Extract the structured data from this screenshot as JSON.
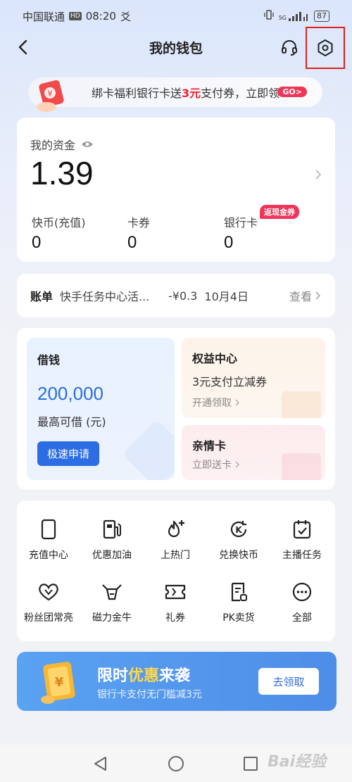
{
  "status_bar": {
    "carrier": "中国联通",
    "hd": "HD",
    "time": "08:20",
    "extra_glyph": "爻",
    "signal_label": "5G",
    "battery": "87"
  },
  "nav": {
    "title": "我的钱包"
  },
  "promo": {
    "text_before": "绑卡福利银行卡送",
    "highlight": "3元",
    "text_after": "支付券，立即领",
    "go_label": "GO>"
  },
  "assets": {
    "title": "我的资金",
    "amount": "1.39",
    "items": [
      {
        "label": "快币(充值)",
        "value": "0"
      },
      {
        "label": "卡券",
        "value": "0"
      },
      {
        "label": "银行卡",
        "value": "0"
      }
    ],
    "cashback_badge": "返现金券"
  },
  "bill": {
    "label": "账单",
    "description": "快手任务中心活...",
    "amount": "-¥0.3",
    "date": "10月4日",
    "view_label": "查看"
  },
  "loan": {
    "title": "借钱",
    "amount": "200,000",
    "subtitle": "最高可借 (元)",
    "button": "极速申请"
  },
  "rights": {
    "title": "权益中心",
    "subtitle": "3元支付立减券",
    "link": "开通领取"
  },
  "family": {
    "title": "亲情卡",
    "link": "立即送卡"
  },
  "services": [
    {
      "label": "充值中心",
      "icon": "phone-icon"
    },
    {
      "label": "优惠加油",
      "icon": "fuel-icon"
    },
    {
      "label": "上热门",
      "icon": "flame-plus-icon"
    },
    {
      "label": "兑换快币",
      "icon": "coin-exchange-icon"
    },
    {
      "label": "主播任务",
      "icon": "calendar-check-icon"
    },
    {
      "label": "粉丝团常亮",
      "icon": "heart-icon"
    },
    {
      "label": "磁力金牛",
      "icon": "bull-icon"
    },
    {
      "label": "礼券",
      "icon": "ticket-icon"
    },
    {
      "label": "PK卖货",
      "icon": "document-icon"
    },
    {
      "label": "全部",
      "icon": "more-icon"
    }
  ],
  "banner": {
    "title_part1": "限时",
    "title_accent": "优惠",
    "title_part2": "来袭",
    "subtitle": "银行卡支付无门槛减3元",
    "button": "去领取",
    "card_symbol": "¥"
  },
  "promo_card_symbol": "¥",
  "watermark": "Bai经验",
  "colors": {
    "accent_blue": "#2c6de4",
    "amount_blue": "#2a6ee0",
    "red_highlight": "#ee2233",
    "badge_pink": "#f0355a",
    "annotation_red": "#e02020"
  }
}
